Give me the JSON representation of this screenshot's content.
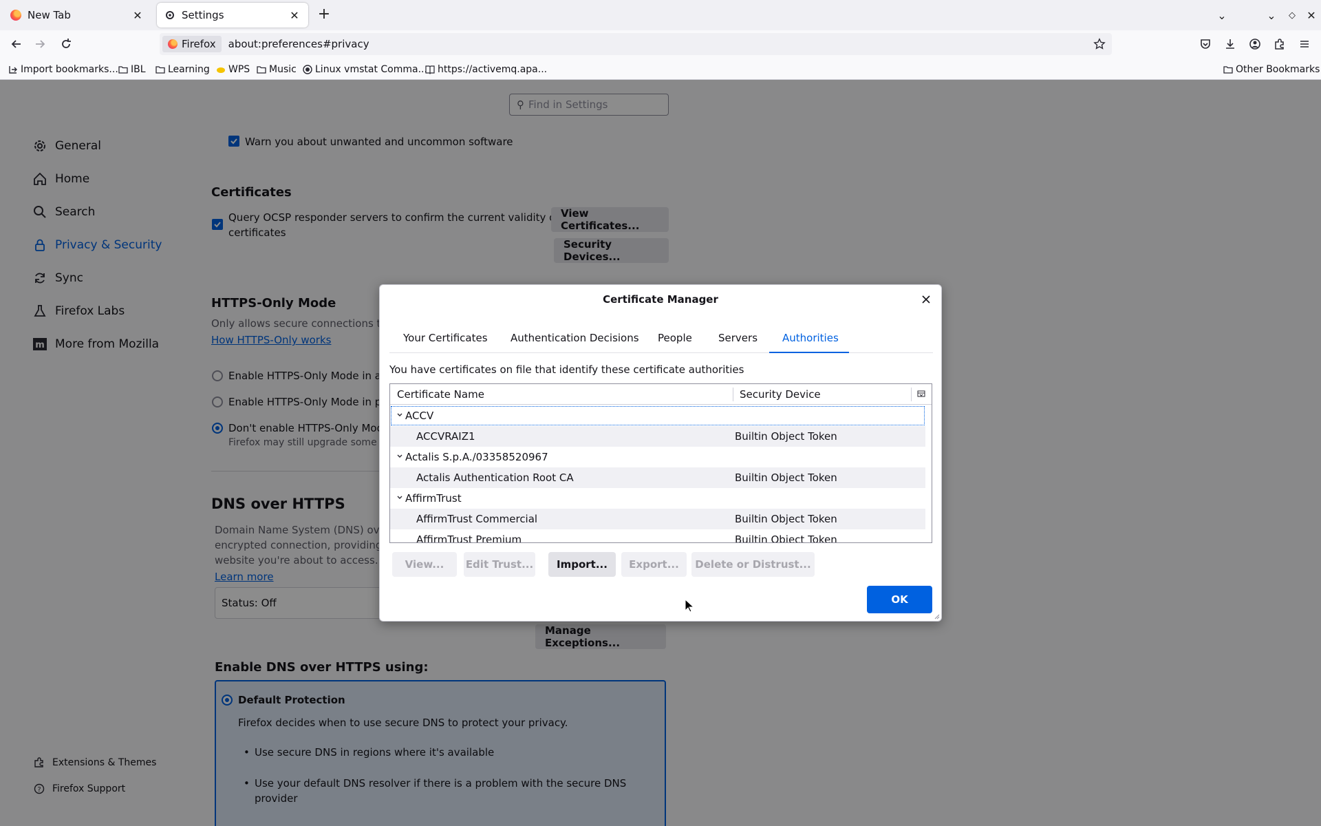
{
  "tabs": [
    {
      "title": "New Tab",
      "icon": "firefox-icon"
    },
    {
      "title": "Settings",
      "icon": "gear-icon",
      "active": true
    }
  ],
  "urlbar": {
    "identity": "Firefox",
    "url": "about:preferences#privacy"
  },
  "bookmarks": [
    {
      "label": "Import bookmarks...",
      "icon": "import-icon"
    },
    {
      "label": "IBL",
      "icon": "folder-icon"
    },
    {
      "label": "Learning",
      "icon": "folder-icon"
    },
    {
      "label": "WPS",
      "icon": "wps-icon"
    },
    {
      "label": "Music",
      "icon": "folder-icon"
    },
    {
      "label": "Linux vmstat Comma...",
      "icon": "site-icon"
    },
    {
      "label": "https://activemq.apa...",
      "icon": "book-icon"
    }
  ],
  "other_bookmarks": "Other Bookmarks",
  "settings": {
    "search_placeholder": "Find in Settings",
    "sidebar": [
      {
        "label": "General",
        "icon": "gear-icon"
      },
      {
        "label": "Home",
        "icon": "home-icon"
      },
      {
        "label": "Search",
        "icon": "search-icon"
      },
      {
        "label": "Privacy & Security",
        "icon": "lock-icon",
        "selected": true
      },
      {
        "label": "Sync",
        "icon": "sync-icon"
      },
      {
        "label": "Firefox Labs",
        "icon": "labs-icon"
      },
      {
        "label": "More from Mozilla",
        "icon": "mozilla-icon"
      }
    ],
    "sidebar_bottom": [
      {
        "label": "Extensions & Themes",
        "icon": "puzzle-icon"
      },
      {
        "label": "Firefox Support",
        "icon": "help-icon"
      }
    ],
    "warn_unwanted": "Warn you about unwanted and uncommon software",
    "certificates_heading": "Certificates",
    "ocsp_text_1": "Query OCSP responder servers to confirm the current validity of",
    "ocsp_text_2": "certificates",
    "view_certs_btn": "View Certificates...",
    "security_devices_btn": "Security Devices...",
    "https_heading": "HTTPS-Only Mode",
    "https_desc": "Only allows secure connections to",
    "https_link": "How HTTPS-Only works",
    "https_opt1": "Enable HTTPS-Only Mode in all",
    "https_opt2": "Enable HTTPS-Only Mode in pri",
    "https_opt3": "Don't enable HTTPS-Only Mode",
    "https_opt3_sub": "Firefox may still upgrade some conn",
    "dns_heading": "DNS over HTTPS",
    "dns_desc_1": "Domain Name System (DNS) over",
    "dns_desc_2": "encrypted connection, providing a",
    "dns_desc_3": "website you're about to access.",
    "dns_learn_more": "Learn more",
    "dns_status": "Status: Off",
    "manage_exceptions_btn": "Manage Exceptions...",
    "dns_using_heading": "Enable DNS over HTTPS using:",
    "default_protection": "Default Protection",
    "default_protection_desc": "Firefox decides when to use secure DNS to protect your privacy.",
    "bullet1": "Use secure DNS in regions where it's available",
    "bullet2_1": "Use your default DNS resolver if there is a problem with the secure DNS",
    "bullet2_2": "provider"
  },
  "dialog": {
    "title": "Certificate Manager",
    "tabs": [
      "Your Certificates",
      "Authentication Decisions",
      "People",
      "Servers",
      "Authorities"
    ],
    "selected_tab": "Authorities",
    "description": "You have certificates on file that identify these certificate authorities",
    "columns": [
      "Certificate Name",
      "Security Device"
    ],
    "rows": [
      {
        "type": "group",
        "name": "ACCV"
      },
      {
        "type": "cert",
        "name": "ACCVRAIZ1",
        "device": "Builtin Object Token"
      },
      {
        "type": "group",
        "name": "Actalis S.p.A./03358520967"
      },
      {
        "type": "cert",
        "name": "Actalis Authentication Root CA",
        "device": "Builtin Object Token"
      },
      {
        "type": "group",
        "name": "AffirmTrust"
      },
      {
        "type": "cert",
        "name": "AffirmTrust Commercial",
        "device": "Builtin Object Token"
      },
      {
        "type": "cert",
        "name": "AffirmTrust Premium",
        "device": "Builtin Object Token"
      }
    ],
    "buttons": {
      "view": "View...",
      "edit_trust": "Edit Trust...",
      "import": "Import...",
      "export": "Export...",
      "delete": "Delete or Distrust..."
    },
    "ok": "OK"
  }
}
